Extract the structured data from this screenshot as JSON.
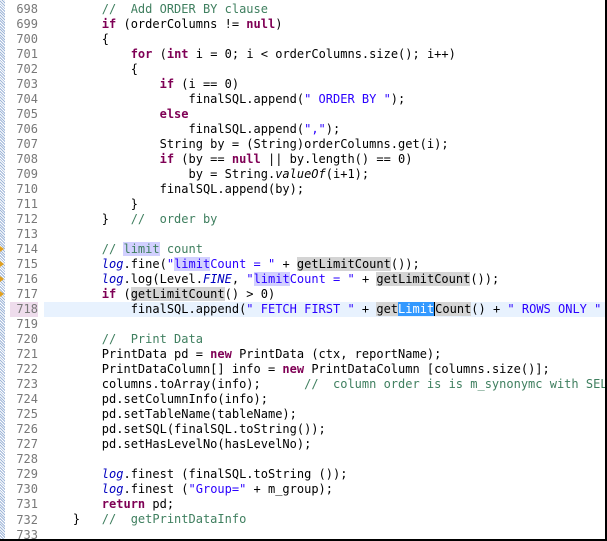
{
  "editor": {
    "current_line": 718,
    "selected_text": "Limit",
    "highlight_word": "limit",
    "lines": [
      {
        "n": 698,
        "segments": [
          [
            "        ",
            ""
          ],
          [
            "//  Add ORDER BY clause",
            "cm"
          ]
        ]
      },
      {
        "n": 699,
        "segments": [
          [
            "        ",
            ""
          ],
          [
            "if",
            "kw"
          ],
          [
            " (orderColumns != ",
            ""
          ],
          [
            "null",
            "kw"
          ],
          [
            ")",
            ""
          ]
        ]
      },
      {
        "n": 700,
        "segments": [
          [
            "        {",
            ""
          ]
        ]
      },
      {
        "n": 701,
        "segments": [
          [
            "            ",
            ""
          ],
          [
            "for",
            "kw"
          ],
          [
            " (",
            ""
          ],
          [
            "int",
            "kw"
          ],
          [
            " i = 0; i < orderColumns.size(); i++)",
            ""
          ]
        ]
      },
      {
        "n": 702,
        "segments": [
          [
            "            {",
            ""
          ]
        ]
      },
      {
        "n": 703,
        "segments": [
          [
            "                ",
            ""
          ],
          [
            "if",
            "kw"
          ],
          [
            " (i == 0)",
            ""
          ]
        ]
      },
      {
        "n": 704,
        "segments": [
          [
            "                    finalSQL.append(",
            ""
          ],
          [
            "\" ORDER BY \"",
            "st"
          ],
          [
            ");",
            ""
          ]
        ]
      },
      {
        "n": 705,
        "segments": [
          [
            "                ",
            ""
          ],
          [
            "else",
            "kw"
          ]
        ]
      },
      {
        "n": 706,
        "segments": [
          [
            "                    finalSQL.append(",
            ""
          ],
          [
            "\",\"",
            "st"
          ],
          [
            ");",
            ""
          ]
        ]
      },
      {
        "n": 707,
        "segments": [
          [
            "                String by = (String)orderColumns.get(i);",
            ""
          ]
        ]
      },
      {
        "n": 708,
        "segments": [
          [
            "                ",
            ""
          ],
          [
            "if",
            "kw"
          ],
          [
            " (by == ",
            ""
          ],
          [
            "null",
            "kw"
          ],
          [
            " || by.length() == 0)",
            ""
          ]
        ]
      },
      {
        "n": 709,
        "segments": [
          [
            "                    by = String.",
            ""
          ],
          [
            "valueOf",
            "sf"
          ],
          [
            "(i+1);",
            ""
          ]
        ]
      },
      {
        "n": 710,
        "segments": [
          [
            "                finalSQL.append(by);",
            ""
          ]
        ]
      },
      {
        "n": 711,
        "segments": [
          [
            "            }",
            ""
          ]
        ]
      },
      {
        "n": 712,
        "segments": [
          [
            "        }   ",
            ""
          ],
          [
            "//  order by",
            "cm"
          ]
        ]
      },
      {
        "n": 713,
        "segments": []
      },
      {
        "n": 714,
        "marker": true,
        "segments": [
          [
            "        ",
            ""
          ],
          [
            "// ",
            "cm"
          ],
          [
            "limit",
            "cm hl"
          ],
          [
            " count",
            "cm"
          ]
        ]
      },
      {
        "n": 715,
        "marker": true,
        "segments": [
          [
            "        ",
            ""
          ],
          [
            "log",
            "it"
          ],
          [
            ".fine(",
            ""
          ],
          [
            "\"",
            "st"
          ],
          [
            "limit",
            "st hl"
          ],
          [
            "Count = \"",
            "st"
          ],
          [
            " + ",
            ""
          ],
          [
            "getLimitCount",
            "occ"
          ],
          [
            "());",
            ""
          ]
        ]
      },
      {
        "n": 716,
        "marker": true,
        "segments": [
          [
            "        ",
            ""
          ],
          [
            "log",
            "it"
          ],
          [
            ".log(Level.",
            ""
          ],
          [
            "FINE",
            "it"
          ],
          [
            ", ",
            ""
          ],
          [
            "\"",
            "st"
          ],
          [
            "limit",
            "st hl"
          ],
          [
            "Count = \"",
            "st"
          ],
          [
            " + ",
            ""
          ],
          [
            "getLimitCount",
            "occ"
          ],
          [
            "());",
            ""
          ]
        ]
      },
      {
        "n": 717,
        "marker": true,
        "segments": [
          [
            "        ",
            ""
          ],
          [
            "if",
            "kw"
          ],
          [
            " (",
            ""
          ],
          [
            "getLimitCount",
            "occ"
          ],
          [
            "() > 0)",
            ""
          ]
        ]
      },
      {
        "n": 718,
        "current": true,
        "segments": [
          [
            "            finalSQL.append(",
            ""
          ],
          [
            "\" FETCH FIRST \"",
            "st"
          ],
          [
            " + ",
            ""
          ],
          [
            "get",
            "occ"
          ],
          [
            "Limit",
            "sel"
          ],
          [
            "Count",
            "occ caret"
          ],
          [
            "() + ",
            ""
          ],
          [
            "\" ROWS ONLY \"",
            "st"
          ],
          [
            " );",
            ""
          ]
        ]
      },
      {
        "n": 719,
        "segments": []
      },
      {
        "n": 720,
        "segments": [
          [
            "        ",
            ""
          ],
          [
            "//  Print Data",
            "cm"
          ]
        ]
      },
      {
        "n": 721,
        "segments": [
          [
            "        PrintData pd = ",
            ""
          ],
          [
            "new",
            "kw"
          ],
          [
            " PrintData (ctx, reportName);",
            ""
          ]
        ]
      },
      {
        "n": 722,
        "segments": [
          [
            "        PrintDataColumn[] info = ",
            ""
          ],
          [
            "new",
            "kw"
          ],
          [
            " PrintDataColumn [columns.size()];",
            ""
          ]
        ]
      },
      {
        "n": 723,
        "segments": [
          [
            "        columns.toArray(info);      ",
            ""
          ],
          [
            "//  column order is is m_synonymc with SELECT",
            "cm"
          ]
        ]
      },
      {
        "n": 724,
        "segments": [
          [
            "        pd.setColumnInfo(info);",
            ""
          ]
        ]
      },
      {
        "n": 725,
        "segments": [
          [
            "        pd.setTableName(tableName);",
            ""
          ]
        ]
      },
      {
        "n": 726,
        "segments": [
          [
            "        pd.setSQL(finalSQL.toString());",
            ""
          ]
        ]
      },
      {
        "n": 727,
        "segments": [
          [
            "        pd.setHasLevelNo(hasLevelNo);",
            ""
          ]
        ]
      },
      {
        "n": 728,
        "segments": []
      },
      {
        "n": 729,
        "segments": [
          [
            "        ",
            ""
          ],
          [
            "log",
            "it"
          ],
          [
            ".finest (finalSQL.toString ());",
            ""
          ]
        ]
      },
      {
        "n": 730,
        "segments": [
          [
            "        ",
            ""
          ],
          [
            "log",
            "it"
          ],
          [
            ".finest (",
            ""
          ],
          [
            "\"Group=\"",
            "st"
          ],
          [
            " + m_group);",
            ""
          ]
        ]
      },
      {
        "n": 731,
        "segments": [
          [
            "        ",
            ""
          ],
          [
            "return",
            "kw"
          ],
          [
            " pd;",
            ""
          ]
        ]
      },
      {
        "n": 732,
        "segments": [
          [
            "    }   ",
            ""
          ],
          [
            "//  getPrintDataInfo",
            "cm"
          ]
        ]
      },
      {
        "n": 733,
        "segments": []
      }
    ]
  }
}
